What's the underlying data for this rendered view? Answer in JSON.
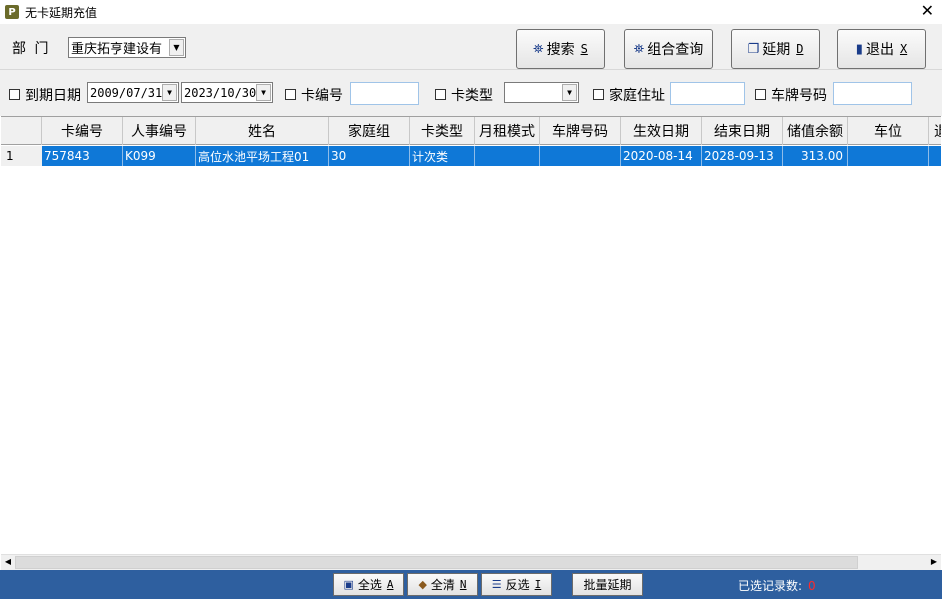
{
  "window": {
    "title": "无卡延期充值",
    "app_icon": "P"
  },
  "toolbar": {
    "dept_label": "部 门",
    "dept_value": "重庆拓亨建设有",
    "search": {
      "label": "搜索",
      "key": "S"
    },
    "combo_query": {
      "label": "组合查询"
    },
    "extend": {
      "label": "延期",
      "key": "D"
    },
    "exit": {
      "label": "退出",
      "key": "X"
    }
  },
  "filters": {
    "expire_date_label": "到期日期",
    "date_from": "2009/07/31",
    "date_to": "2023/10/30",
    "card_no_label": "卡编号",
    "card_type_label": "卡类型",
    "address_label": "家庭住址",
    "plate_label": "车牌号码"
  },
  "grid": {
    "columns": [
      "卡编号",
      "人事编号",
      "姓名",
      "家庭组",
      "卡类型",
      "月租模式",
      "车牌号码",
      "生效日期",
      "结束日期",
      "储值余额",
      "车位",
      "退"
    ],
    "rows": [
      {
        "index": "1",
        "card_no": "757843",
        "staff_no": "K099",
        "name": "高位水池平场工程01",
        "family_group": "30",
        "card_type": "计次类",
        "monthly_mode": "",
        "plate": "",
        "start_date": "2020-08-14",
        "end_date": "2028-09-13",
        "balance": "313.00",
        "parking": ""
      }
    ]
  },
  "bottom": {
    "select_all": {
      "label": "全选",
      "key": "A"
    },
    "clear_all": {
      "label": "全清",
      "key": "N"
    },
    "invert": {
      "label": "反选",
      "key": "I"
    },
    "batch_extend": "批量延期",
    "selected_count_label": "已选记录数:",
    "selected_count": "0"
  },
  "colors": {
    "selection": "#0f78d7",
    "bottom_bar": "#2e5f9f",
    "count": "#ff2a2a"
  }
}
